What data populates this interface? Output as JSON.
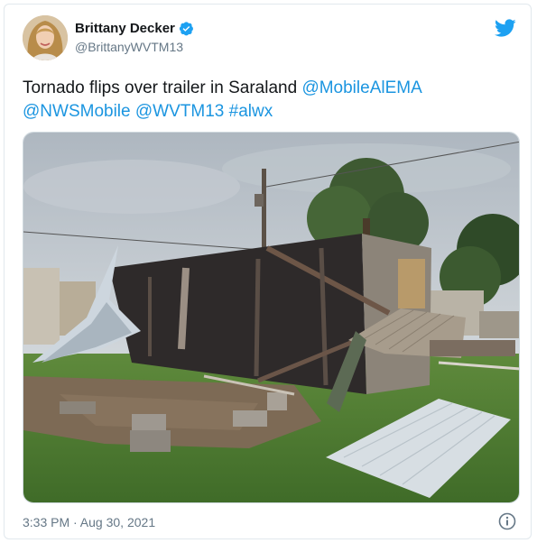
{
  "author": {
    "display_name": "Brittany Decker",
    "handle": "@BrittanyWVTM13",
    "verified": true
  },
  "tweet": {
    "text_plain": "Tornado flips over trailer in Saraland ",
    "mentions": [
      "@MobileAlEMA",
      "@NWSMobile",
      "@WVTM13"
    ],
    "hashtags": [
      "#alwx"
    ]
  },
  "media": {
    "subject": "tornado-damaged overturned trailer"
  },
  "meta": {
    "timestamp": "3:33 PM · Aug 30, 2021"
  },
  "colors": {
    "accent": "#1b95e0",
    "twitter_blue": "#1da1f2",
    "text": "#14171a",
    "muted": "#657786"
  },
  "icons": {
    "brand": "twitter-bird-icon",
    "verified": "verified-badge-icon",
    "info": "info-icon"
  }
}
